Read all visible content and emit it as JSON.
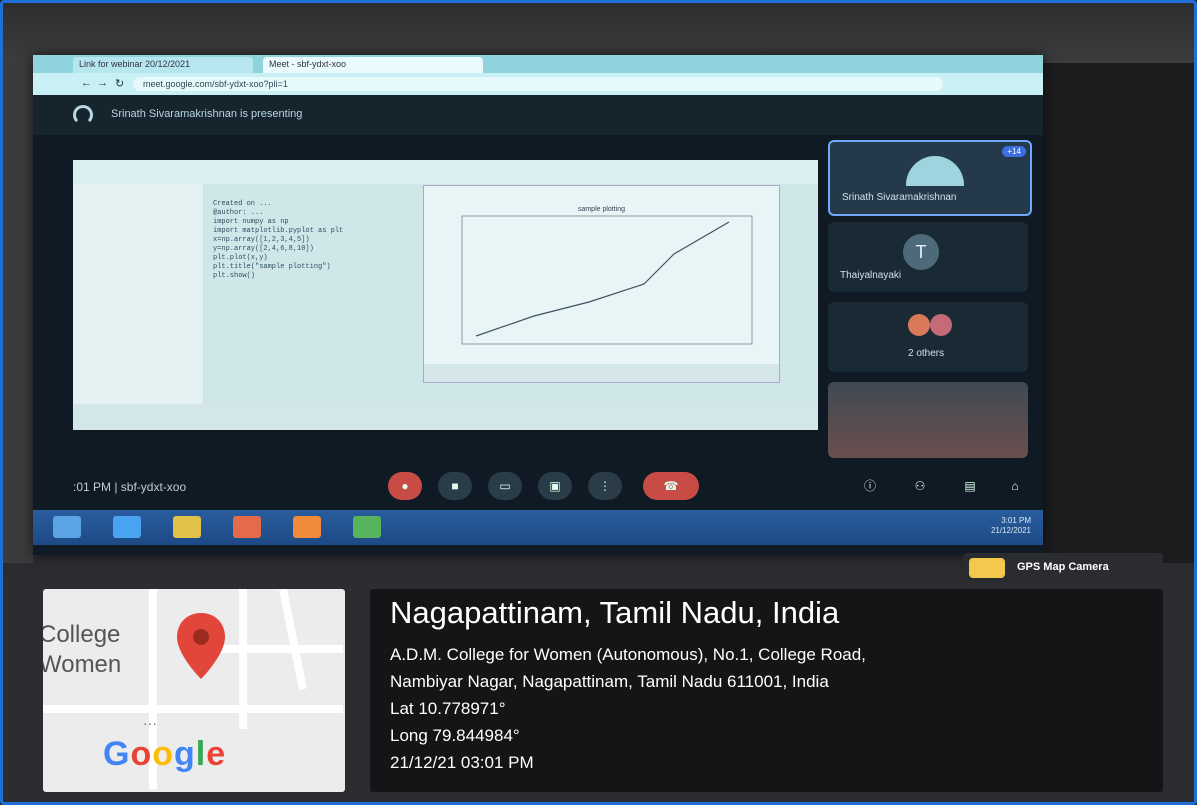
{
  "browser": {
    "tabs": [
      "Link for webinar 20/12/2021",
      "Meet - sbf-ydxt-xoo"
    ],
    "url": "meet.google.com/sbf-ydxt-xoo?pli=1"
  },
  "meet": {
    "presenting_text": "Srinath Sivaramakrishnan is presenting",
    "meeting_code": ":01 PM  |  sbf-ydxt-xoo",
    "participants": [
      {
        "name": "Srinath Sivaramakrishnan",
        "badge": "+14"
      },
      {
        "name": "Thaiyalnayaki",
        "initial": "T"
      },
      {
        "name": "2 others"
      }
    ]
  },
  "shared_screen": {
    "figure_title": "sample plotting",
    "code_lines": [
      "Created on ...",
      "@author: ...",
      "import numpy as np",
      "import matplotlib.pyplot as plt",
      "x=np.array([1,2,3,4,5])",
      "y=np.array([2,4,6,8,10])",
      "plt.plot(x,y)",
      "plt.title(\"sample plotting\")",
      "plt.show()"
    ]
  },
  "gps_camera": {
    "label": "GPS Map Camera"
  },
  "map": {
    "label_line1": "College",
    "label_line2": "Women",
    "brand": "Google"
  },
  "location": {
    "title": "Nagapattinam, Tamil Nadu, India",
    "address_line1": "A.D.M. College for Women (Autonomous), No.1, College Road,",
    "address_line2": "Nambiyar Nagar, Nagapattinam, Tamil Nadu 611001, India",
    "lat": "Lat 10.778971°",
    "long": "Long 79.844984°",
    "datetime": "21/12/21 03:01 PM"
  },
  "taskbar": {
    "time": "3:01 PM",
    "date": "21/12/2021"
  },
  "colors": {
    "accent_blue": "#1f6fd6",
    "pin_red": "#e2463a",
    "end_call_red": "#c94b45"
  }
}
